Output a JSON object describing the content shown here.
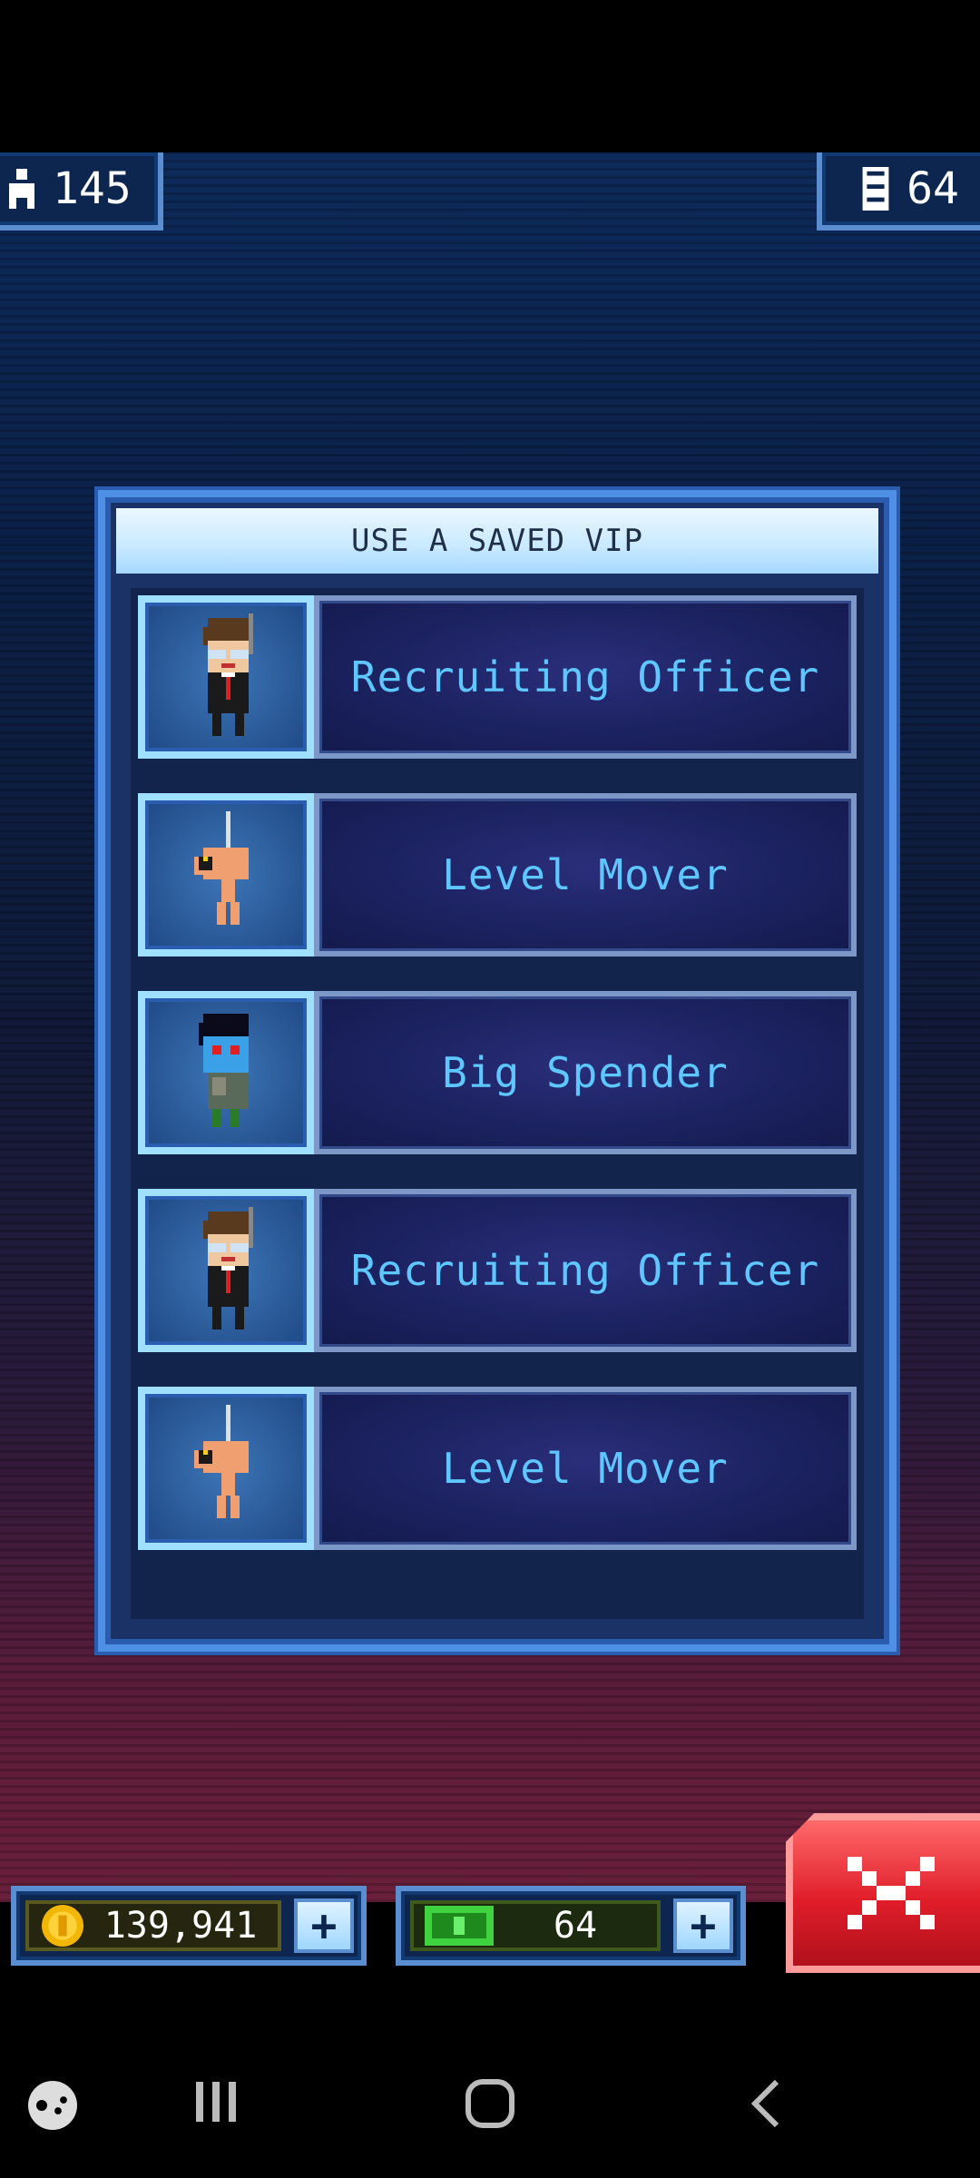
{
  "top_bar": {
    "population": "145",
    "floors": "64"
  },
  "dialog": {
    "title": "USE A SAVED VIP",
    "vips": [
      {
        "name": "Recruiting Officer",
        "portrait": "recruiting-officer-portrait"
      },
      {
        "name": "Level Mover",
        "portrait": "level-mover-portrait"
      },
      {
        "name": "Big Spender",
        "portrait": "big-spender-portrait"
      },
      {
        "name": "Recruiting Officer",
        "portrait": "recruiting-officer-portrait"
      },
      {
        "name": "Level Mover",
        "portrait": "level-mover-portrait"
      }
    ]
  },
  "bottom_bar": {
    "coins": "139,941",
    "bux": "64"
  },
  "colors": {
    "accent_blue": "#5fc7ff",
    "close_red": "#e01e2a",
    "bux_green": "#3fd43f",
    "coin_gold": "#f2b705"
  },
  "icons": {
    "population": "person-icon",
    "floors": "building-icon",
    "coins": "coin-icon",
    "bux": "bux-icon",
    "close": "close-icon"
  }
}
